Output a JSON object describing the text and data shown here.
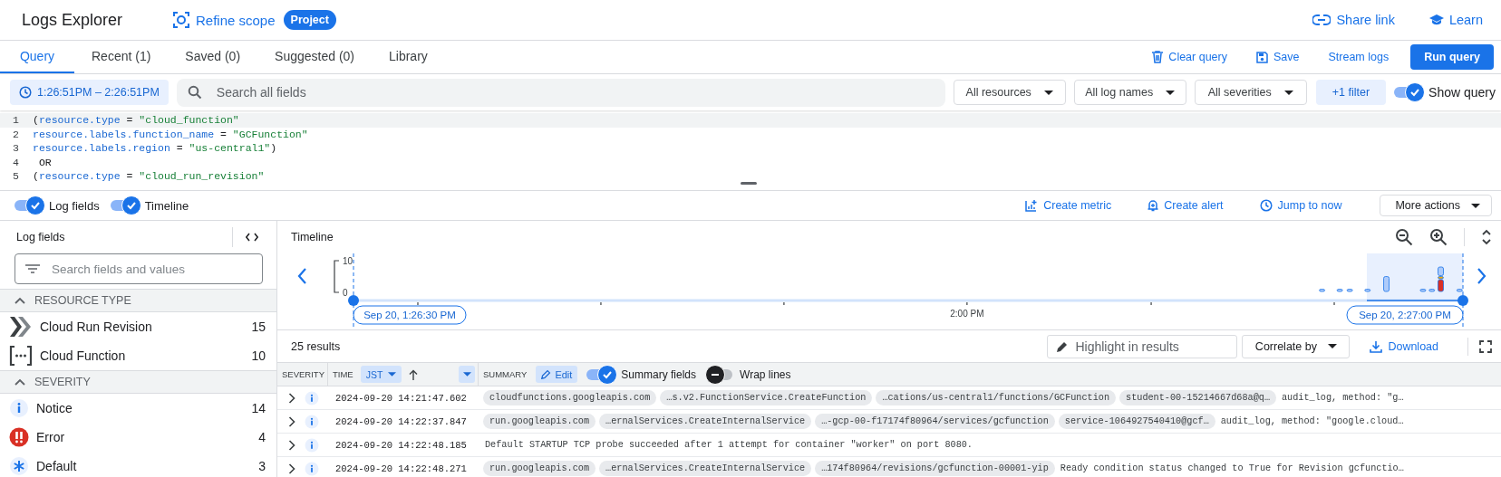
{
  "header": {
    "title": "Logs Explorer",
    "scope_button": "Refine scope",
    "scope_badge": "Project",
    "links": [
      {
        "label": "Share link",
        "kind": "link"
      },
      {
        "label": "Learn",
        "kind": "learn"
      }
    ]
  },
  "tabs": [
    {
      "label": "Query",
      "selected": true
    },
    {
      "label": "Recent (1)",
      "selected": false
    },
    {
      "label": "Saved (0)",
      "selected": false
    },
    {
      "label": "Suggested (0)",
      "selected": false
    },
    {
      "label": "Library",
      "selected": false
    }
  ],
  "query_actions": [
    {
      "label": "Clear query",
      "kind": "clear"
    },
    {
      "label": "Save",
      "kind": "save"
    },
    {
      "label": "Stream logs",
      "kind": "stream"
    },
    {
      "label": "Run query",
      "kind": "run"
    }
  ],
  "time_range": "1:26:51PM – 2:26:51PM",
  "search": {
    "placeholder": "Search all fields"
  },
  "filters": [
    "All resources",
    "All log names",
    "All severities"
  ],
  "extra_filter": "+1 filter",
  "show_query": {
    "label": "Show query",
    "on": true
  },
  "query_lines": [
    {
      "number": "1",
      "text": "(resource.type = \"cloud_function\"",
      "active": true
    },
    {
      "number": "2",
      "text": "resource.labels.function_name = \"GCFunction\"",
      "active": false
    },
    {
      "number": "3",
      "text": "resource.labels.region = \"us-central1\")",
      "active": false
    },
    {
      "number": "4",
      "text": " OR",
      "active": false
    },
    {
      "number": "5",
      "text": "(resource.type = \"cloud_run_revision\"",
      "active": false
    }
  ],
  "panel_toggles": [
    {
      "label": "Log fields",
      "on": true
    },
    {
      "label": "Timeline",
      "on": true
    }
  ],
  "timeline_actions": [
    {
      "label": "Create metric",
      "kind": "metric"
    },
    {
      "label": "Create alert",
      "kind": "alert"
    },
    {
      "label": "Jump to now",
      "kind": "jump"
    }
  ],
  "more_actions": "More actions",
  "log_fields": {
    "title": "Log fields",
    "search": {
      "placeholder": "Search fields and values"
    },
    "sections": [
      {
        "title": "RESOURCE TYPE",
        "expanded": true,
        "items": [
          {
            "kind": "cloud_run",
            "label": "Cloud Run Revision",
            "count": "15"
          },
          {
            "kind": "cloud_function",
            "label": "Cloud Function",
            "count": "10"
          }
        ]
      },
      {
        "title": "SEVERITY",
        "expanded": true,
        "items": [
          {
            "kind": "notice",
            "label": "Notice",
            "count": "14"
          },
          {
            "kind": "error",
            "label": "Error",
            "count": "4"
          },
          {
            "kind": "default",
            "label": "Default",
            "count": "3"
          }
        ]
      }
    ]
  },
  "timeline": {
    "title": "Timeline",
    "range_start": "Sep 20, 1:26:30 PM",
    "range_end": "Sep 20, 2:27:00 PM",
    "y_labels": [
      "10",
      "0"
    ],
    "x_label": "2:00 PM"
  },
  "results": {
    "count": "25 results",
    "highlight": {
      "placeholder": "Highlight in results"
    },
    "correlate": "Correlate by",
    "download": "Download"
  },
  "table": {
    "columns": [
      {
        "label": "SEVERITY"
      },
      {
        "label": "TIME",
        "timezone": "JST"
      },
      {
        "label": "SUMMARY",
        "edit": "Edit"
      }
    ],
    "summary_toggles": [
      {
        "label": "Summary fields",
        "on": true
      },
      {
        "label": "Wrap lines",
        "on": false
      }
    ],
    "rows": [
      {
        "kind": "notice",
        "time": "2024-09-20 14:21:47.602",
        "chips": [
          "cloudfunctions.googleapis.com",
          "…s.v2.FunctionService.CreateFunction",
          "…cations/us-central1/functions/GCFunction",
          "student-00-15214667d68a@q…"
        ],
        "text": "audit_log, method: \"g…"
      },
      {
        "kind": "notice",
        "time": "2024-09-20 14:22:37.847",
        "chips": [
          "run.googleapis.com",
          "…ernalServices.CreateInternalService",
          "…-gcp-00-f17174f80964/services/gcfunction",
          "service-1064927540410@gcf…"
        ],
        "text": "audit_log, method: \"google.cloud…"
      },
      {
        "kind": "notice",
        "time": "2024-09-20 14:22:48.185",
        "message": "Default STARTUP TCP probe succeeded after 1 attempt for container \"worker\" on port 8080."
      },
      {
        "kind": "notice",
        "time": "2024-09-20 14:22:48.271",
        "chips": [
          "run.googleapis.com",
          "…ernalServices.CreateInternalService",
          "…174f80964/revisions/gcfunction-00001-yip"
        ],
        "text": "Ready condition status changed to True for Revision gcfunctio…"
      }
    ]
  }
}
